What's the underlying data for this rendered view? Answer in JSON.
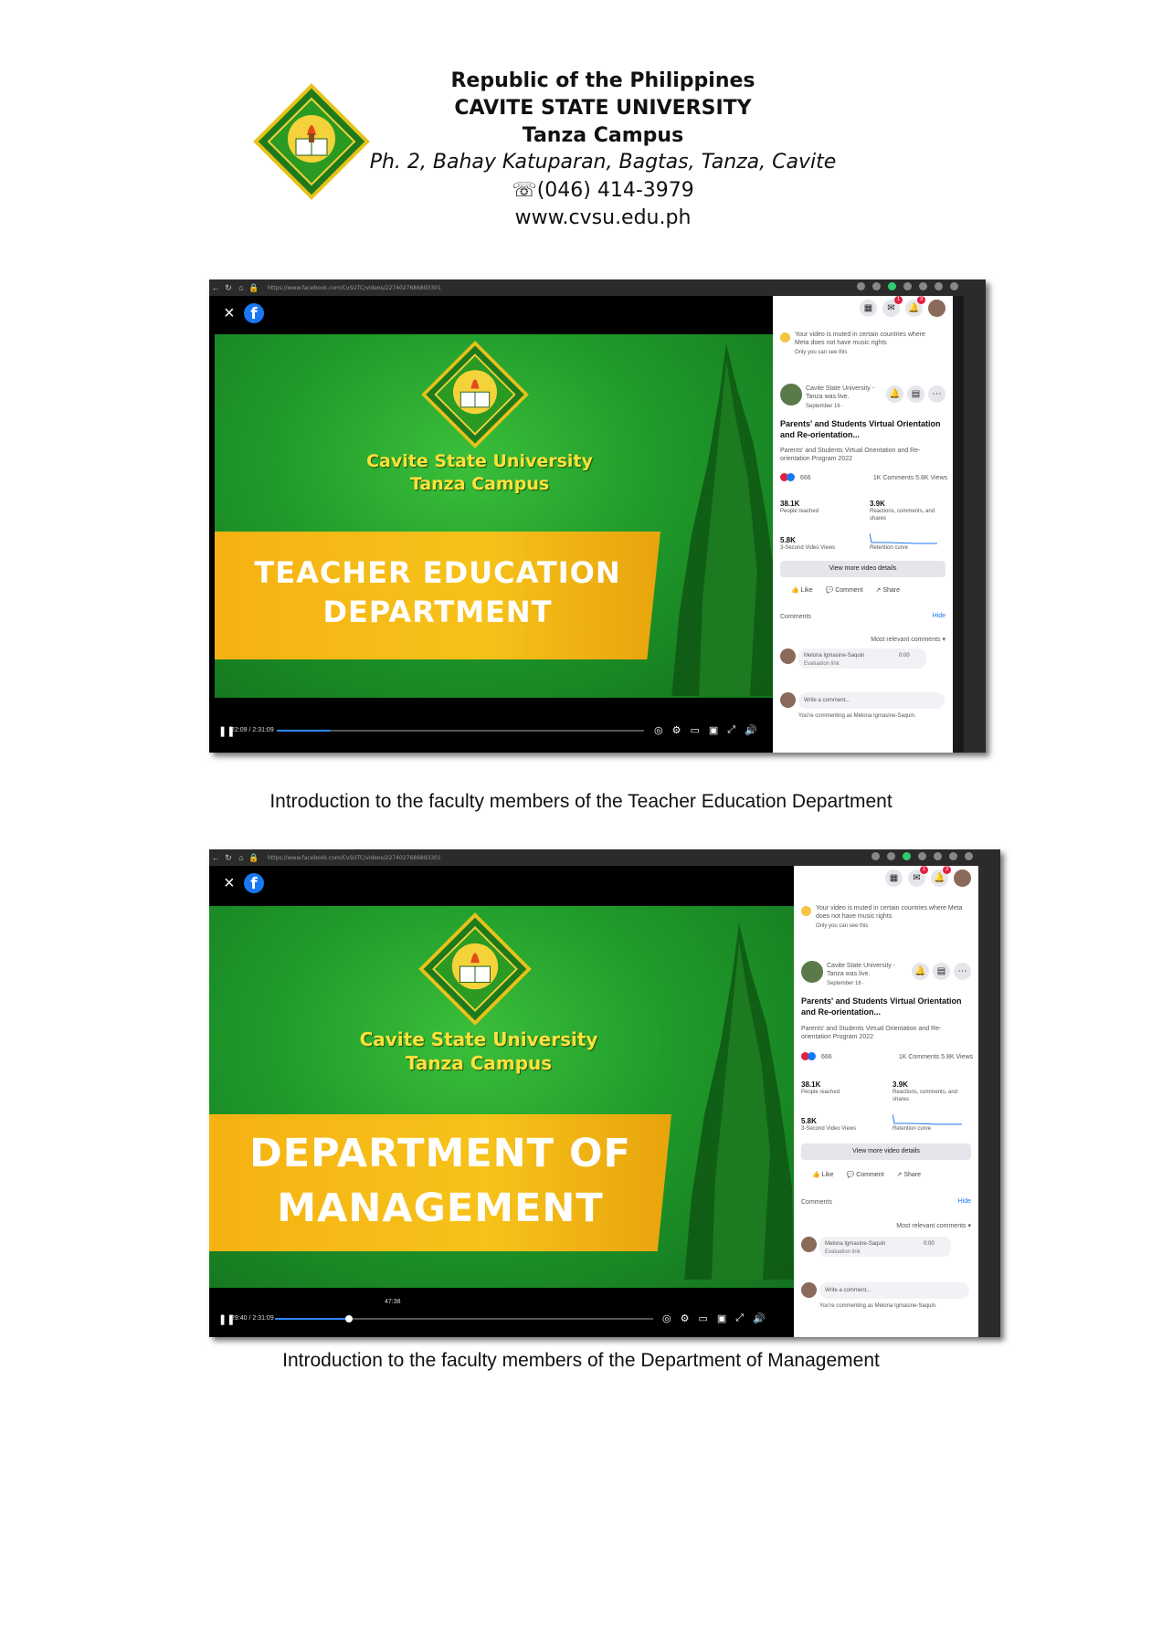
{
  "header": {
    "line1": "Republic of the Philippines",
    "line2": "CAVITE STATE UNIVERSITY",
    "line3": "Tanza Campus",
    "line4": "Ph. 2, Bahay Katuparan, Bagtas, Tanza, Cavite",
    "phone": "☏(046) 414-3979",
    "website": "www.cvsu.edu.ph"
  },
  "screenshots": [
    {
      "url": "https://www.facebook.com/CvSUTC/videos/2274027686893301",
      "school_name": "Cavite State University",
      "campus": "Tanza Campus",
      "banner_line1": "TEACHER EDUCATION",
      "banner_line2": "DEPARTMENT",
      "time": "22:09 / 2:31:09",
      "progress": 0.146,
      "hover_time": "",
      "caption": "Introduction to the faculty members of the Teacher Education Department"
    },
    {
      "url": "https://www.facebook.com/CvSUTC/videos/2274027686893301",
      "school_name": "Cavite State University",
      "campus": "Tanza Campus",
      "banner_line1": "DEPARTMENT OF",
      "banner_line2": "MANAGEMENT",
      "time": "29:40 / 2:31:09",
      "progress": 0.196,
      "hover_time": "47:38",
      "caption": "Introduction to the faculty members of the Department of Management"
    }
  ],
  "panel": {
    "notice": "Your video is muted in certain countries where Meta does not have music rights",
    "notice_sub": "Only you can see this",
    "page_name": "Cavite State University - Tanza was live.",
    "date": "September 16 · ",
    "post_title": "Parents' and Students Virtual Orientation and Re-orientation...",
    "post_desc": "Parents' and Students Virtual Orientation and Re-orientation Program 2022",
    "reactions": "666",
    "comments_views": "1K Comments  5.8K Views",
    "stat1_value": "38.1K",
    "stat1_label": "People reached",
    "stat2_value": "3.9K",
    "stat2_label": "Reactions, comments, and shares",
    "stat3_value": "5.8K",
    "stat3_label": "3-Second Video Views",
    "stat4_label": "Retention curve",
    "view_more": "View more video details",
    "like": "Like",
    "comment": "Comment",
    "share": "Share",
    "comments_label": "Comments",
    "hide": "Hide",
    "most_relevant": "Most relevant comments ▾",
    "commenter": "Melona Igmasine-Saquin",
    "comment_time": "0:00",
    "comment_snippet": "Evaluation link",
    "write_comment": "Write a comment...",
    "commenting_as": "You're commenting as Melona Igmasine-Saquin."
  },
  "colors": {
    "fb_blue": "#1877f2",
    "green": "#1f9a2a",
    "banner_orange": "#f5b212",
    "yellow_text": "#ffe23a"
  }
}
